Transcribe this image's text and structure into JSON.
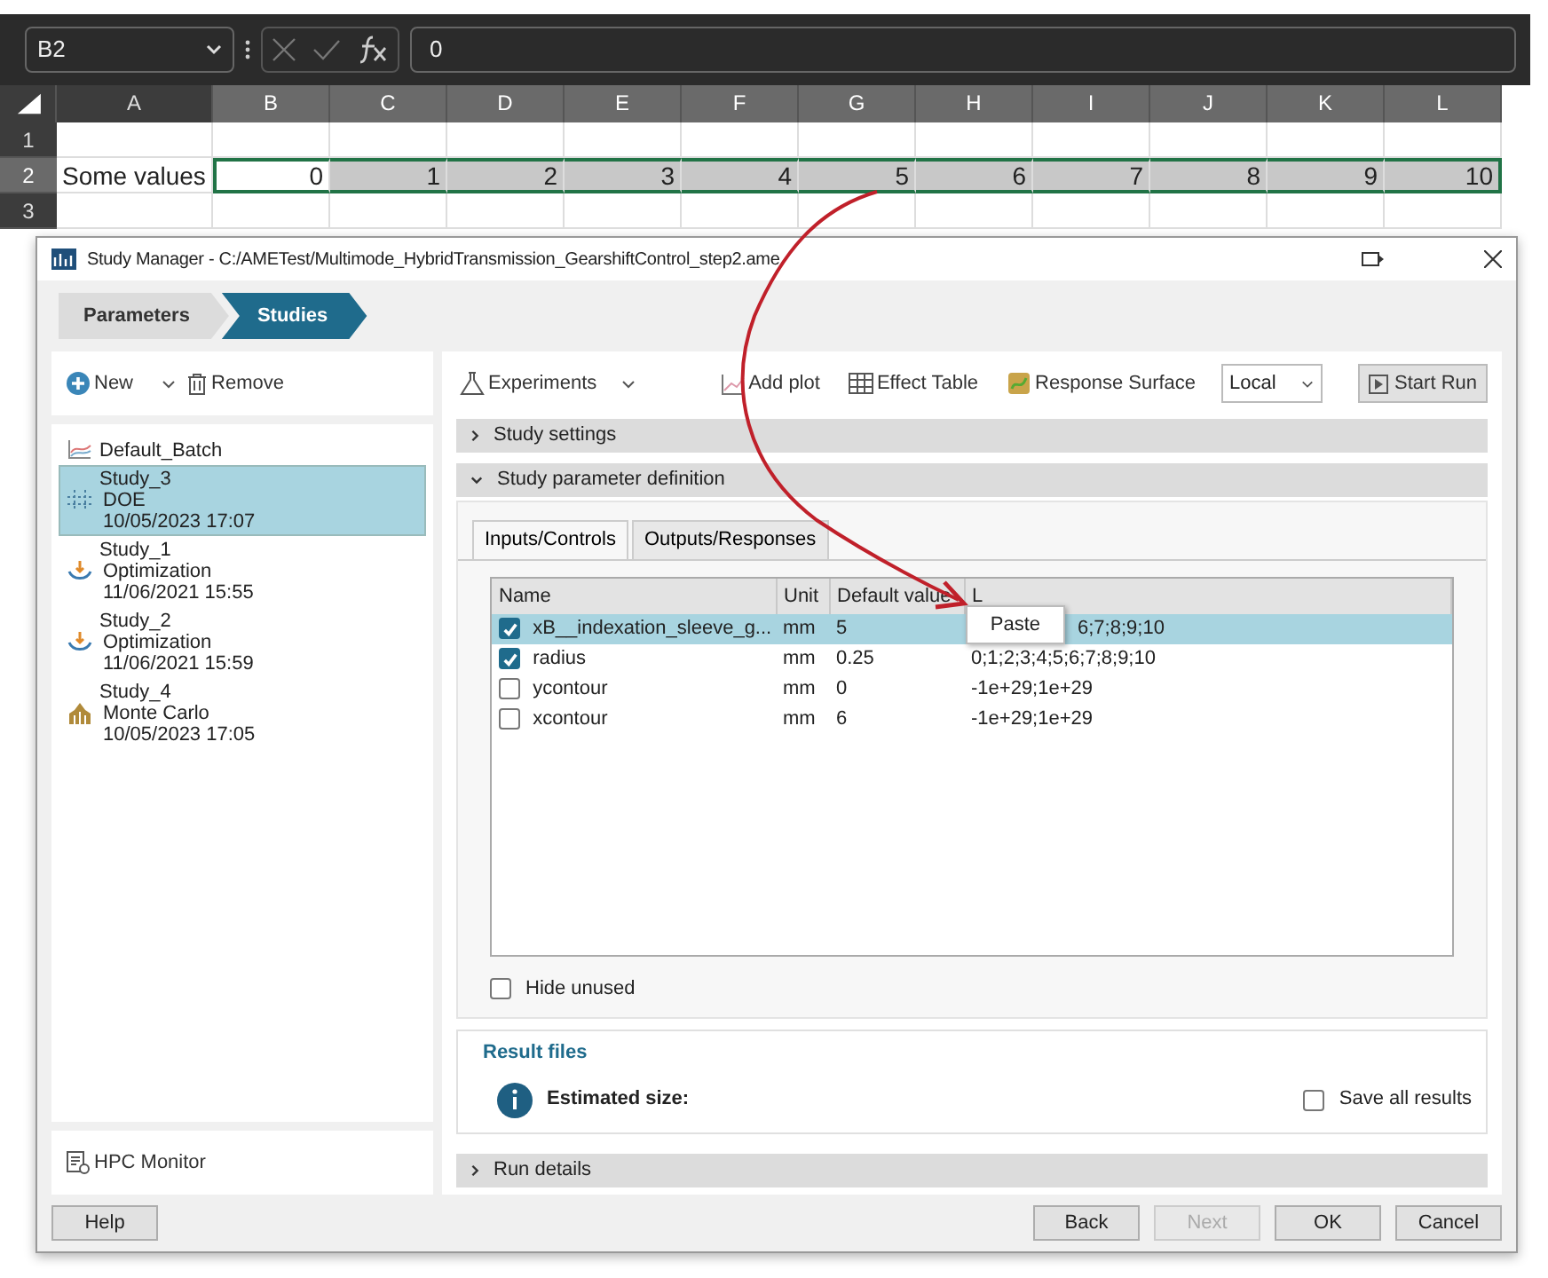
{
  "spreadsheet": {
    "name_box": "B2",
    "formula": "0",
    "columns": [
      "A",
      "B",
      "C",
      "D",
      "E",
      "F",
      "G",
      "H",
      "I",
      "J",
      "K",
      "L"
    ],
    "rows": [
      {
        "header": "1",
        "selected": false,
        "cells": []
      },
      {
        "header": "2",
        "selected": true,
        "cells": [
          {
            "text": "Some values",
            "selected": false,
            "active": false
          },
          {
            "text": "0",
            "selected": true,
            "active": true
          },
          {
            "text": "1",
            "selected": true,
            "active": false
          },
          {
            "text": "2",
            "selected": true,
            "active": false
          },
          {
            "text": "3",
            "selected": true,
            "active": false
          },
          {
            "text": "4",
            "selected": true,
            "active": false
          },
          {
            "text": "5",
            "selected": true,
            "active": false
          },
          {
            "text": "6",
            "selected": true,
            "active": false
          },
          {
            "text": "7",
            "selected": true,
            "active": false
          },
          {
            "text": "8",
            "selected": true,
            "active": false
          },
          {
            "text": "9",
            "selected": true,
            "active": false
          },
          {
            "text": "10",
            "selected": true,
            "active": false
          }
        ]
      },
      {
        "header": "3",
        "selected": false,
        "cells": []
      }
    ]
  },
  "window": {
    "title": "Study Manager - C:/AMETest/Multimode_HybridTransmission_GearshiftControl_step2.ame"
  },
  "breadcrumb": [
    {
      "label": "Parameters",
      "selected": false
    },
    {
      "label": "Studies",
      "selected": true
    }
  ],
  "left_toolbar": {
    "new": "New",
    "remove": "Remove"
  },
  "studies": [
    {
      "kind": "batch",
      "name": "Default_Batch",
      "selected": false
    },
    {
      "kind": "doe",
      "name": "Study_3",
      "type": "DOE",
      "date": "10/05/2023 17:07",
      "selected": true
    },
    {
      "kind": "optimization",
      "name": "Study_1",
      "type": "Optimization",
      "date": "11/06/2021 15:55",
      "selected": false
    },
    {
      "kind": "optimization",
      "name": "Study_2",
      "type": "Optimization",
      "date": "11/06/2021 15:59",
      "selected": false
    },
    {
      "kind": "monte_carlo",
      "name": "Study_4",
      "type": "Monte Carlo",
      "date": "10/05/2023 17:05",
      "selected": false
    }
  ],
  "hpc_monitor": "HPC Monitor",
  "toolbar": {
    "experiments": "Experiments",
    "add_plot": "Add plot",
    "effect_table": "Effect Table",
    "response_surface": "Response Surface",
    "location": "Local",
    "start_run": "Start Run"
  },
  "sections": [
    {
      "title": "Study settings",
      "expanded": false
    },
    {
      "title": "Study parameter definition",
      "expanded": true
    }
  ],
  "tabs": [
    {
      "label": "Inputs/Controls",
      "selected": true
    },
    {
      "label": "Outputs/Responses",
      "selected": false
    }
  ],
  "table": {
    "columns": [
      "Name",
      "Unit",
      "Default value",
      "L"
    ],
    "rows": [
      {
        "name": "xB__indexation_sleeve_g...",
        "unit": "mm",
        "default": "5",
        "limits": "6;7;8;9;10",
        "checked": true,
        "selected": true
      },
      {
        "name": "radius",
        "unit": "mm",
        "default": "0.25",
        "limits": "0;1;2;3;4;5;6;7;8;9;10",
        "checked": true,
        "selected": false
      },
      {
        "name": "ycontour",
        "unit": "mm",
        "default": "0",
        "limits": "-1e+29;1e+29",
        "checked": false,
        "selected": false
      },
      {
        "name": "xcontour",
        "unit": "mm",
        "default": "6",
        "limits": "-1e+29;1e+29",
        "checked": false,
        "selected": false
      }
    ]
  },
  "context_menu": [
    "Paste"
  ],
  "hide_unused": {
    "label": "Hide unused",
    "checked": false
  },
  "result_files": {
    "title": "Result files",
    "estimated_size": "Estimated size:",
    "save_all": {
      "label": "Save all results",
      "checked": false
    }
  },
  "run_details": {
    "title": "Run details",
    "expanded": false
  },
  "buttons": [
    {
      "label": "Help",
      "disabled": false
    },
    {
      "label": "Back",
      "disabled": false
    },
    {
      "label": "Next",
      "disabled": true
    },
    {
      "label": "OK",
      "disabled": false
    },
    {
      "label": "Cancel",
      "disabled": false
    }
  ]
}
